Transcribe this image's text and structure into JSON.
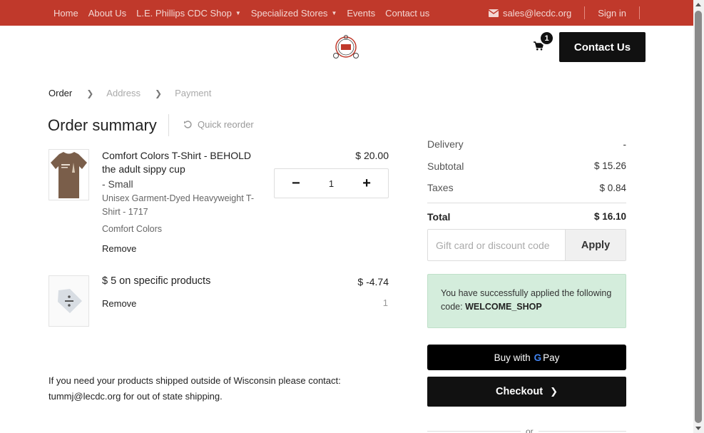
{
  "topnav": {
    "items": [
      {
        "label": "Home"
      },
      {
        "label": "About Us"
      },
      {
        "label": "L.E. Phillips CDC Shop",
        "dropdown": true
      },
      {
        "label": "Specialized Stores",
        "dropdown": true
      },
      {
        "label": "Events"
      },
      {
        "label": "Contact us"
      }
    ],
    "email": "sales@lecdc.org",
    "signin": "Sign in"
  },
  "header": {
    "cart_count": "1",
    "contact_button": "Contact Us"
  },
  "breadcrumb": {
    "steps": [
      "Order",
      "Address",
      "Payment"
    ]
  },
  "order": {
    "title": "Order summary",
    "quick_reorder": "Quick reorder",
    "product": {
      "name": "Comfort Colors T-Shirt - BEHOLD the adult sippy cup",
      "variant": "- Small",
      "description": "Unisex Garment-Dyed Heavyweight T-Shirt - 1717",
      "brand": "Comfort Colors",
      "remove": "Remove",
      "price": "$ 20.00",
      "quantity": "1"
    },
    "discount": {
      "name": "$ 5 on specific products",
      "remove": "Remove",
      "price": "$ -4.74",
      "quantity": "1"
    },
    "shipping_note": "If you need your products shipped outside of Wisconsin please contact: tummj@lecdc.org for out of state shipping."
  },
  "totals": {
    "delivery_label": "Delivery",
    "delivery_value": "-",
    "subtotal_label": "Subtotal",
    "subtotal_value": "$ 15.26",
    "taxes_label": "Taxes",
    "taxes_value": "$ 0.84",
    "total_label": "Total",
    "total_value": "$ 16.10"
  },
  "promo": {
    "placeholder": "Gift card or discount code",
    "apply": "Apply",
    "success_text": "You have successfully applied the following code:",
    "code": "WELCOME_SHOP"
  },
  "payment": {
    "gpay_prefix": "Buy with",
    "gpay_g": "G",
    "gpay_word": "Pay",
    "checkout": "Checkout",
    "or": "or"
  },
  "colors": {
    "nav_red": "#c0392b",
    "button_dark": "#111111",
    "alert_green": "#d4eddc"
  }
}
